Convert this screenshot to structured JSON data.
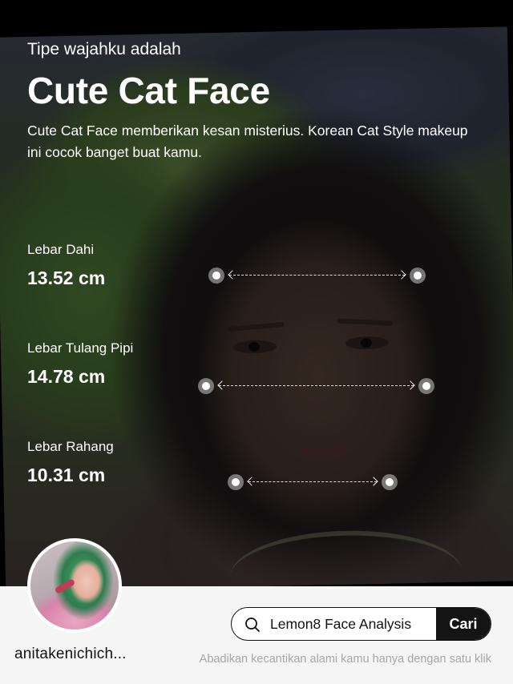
{
  "header": {
    "subtitle": "Tipe wajahku adalah",
    "title": "Cute Cat Face",
    "description": "Cute Cat Face memberikan kesan misterius. Korean Cat Style makeup ini cocok banget buat kamu."
  },
  "metrics": [
    {
      "label": "Lebar Dahi",
      "value": "13.52 cm"
    },
    {
      "label": "Lebar Tulang Pipi",
      "value": "14.78 cm"
    },
    {
      "label": "Lebar Rahang",
      "value": "10.31 cm"
    }
  ],
  "profile": {
    "username": "anitakenichich..."
  },
  "search": {
    "query": "Lemon8 Face Analysis",
    "button_label": "Cari",
    "icon": "search-icon"
  },
  "tagline": "Abadikan kecantikan alami kamu hanya dengan satu klik"
}
